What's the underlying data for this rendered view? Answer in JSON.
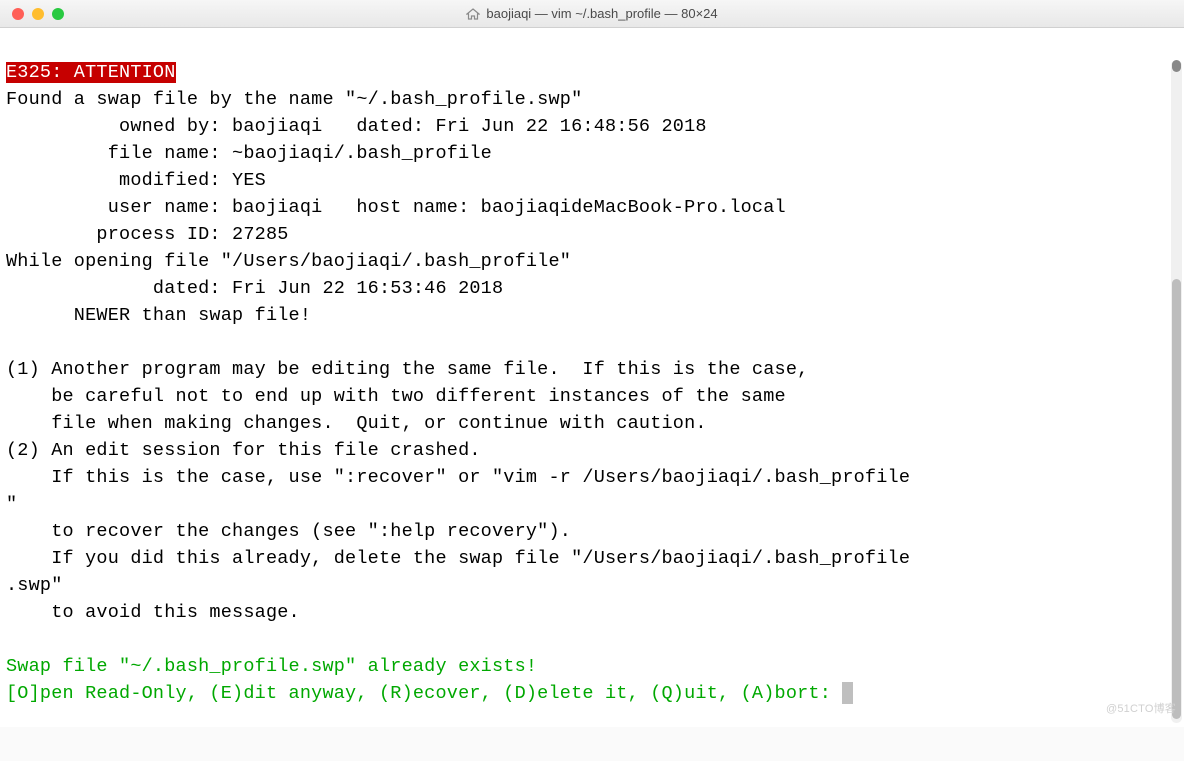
{
  "window": {
    "title": "baojiaqi — vim ~/.bash_profile — 80×24"
  },
  "vim": {
    "error_code": "E325: ATTENTION",
    "lines": {
      "l1": "Found a swap file by the name \"~/.bash_profile.swp\"",
      "l2": "          owned by: baojiaqi   dated: Fri Jun 22 16:48:56 2018",
      "l3": "         file name: ~baojiaqi/.bash_profile",
      "l4": "          modified: YES",
      "l5": "         user name: baojiaqi   host name: baojiaqideMacBook-Pro.local",
      "l6": "        process ID: 27285",
      "l7": "While opening file \"/Users/baojiaqi/.bash_profile\"",
      "l8": "             dated: Fri Jun 22 16:53:46 2018",
      "l9": "      NEWER than swap file!",
      "l10": "",
      "l11": "(1) Another program may be editing the same file.  If this is the case,",
      "l12": "    be careful not to end up with two different instances of the same",
      "l13": "    file when making changes.  Quit, or continue with caution.",
      "l14": "(2) An edit session for this file crashed.",
      "l15": "    If this is the case, use \":recover\" or \"vim -r /Users/baojiaqi/.bash_profile",
      "l16": "\"",
      "l17": "    to recover the changes (see \":help recovery\").",
      "l18": "    If you did this already, delete the swap file \"/Users/baojiaqi/.bash_profile",
      "l19": ".swp\"",
      "l20": "    to avoid this message.",
      "l21": ""
    },
    "prompt1": "Swap file \"~/.bash_profile.swp\" already exists!",
    "prompt2": "[O]pen Read-Only, (E)dit anyway, (R)ecover, (D)elete it, (Q)uit, (A)bort: "
  },
  "watermark": "@51CTO博客"
}
